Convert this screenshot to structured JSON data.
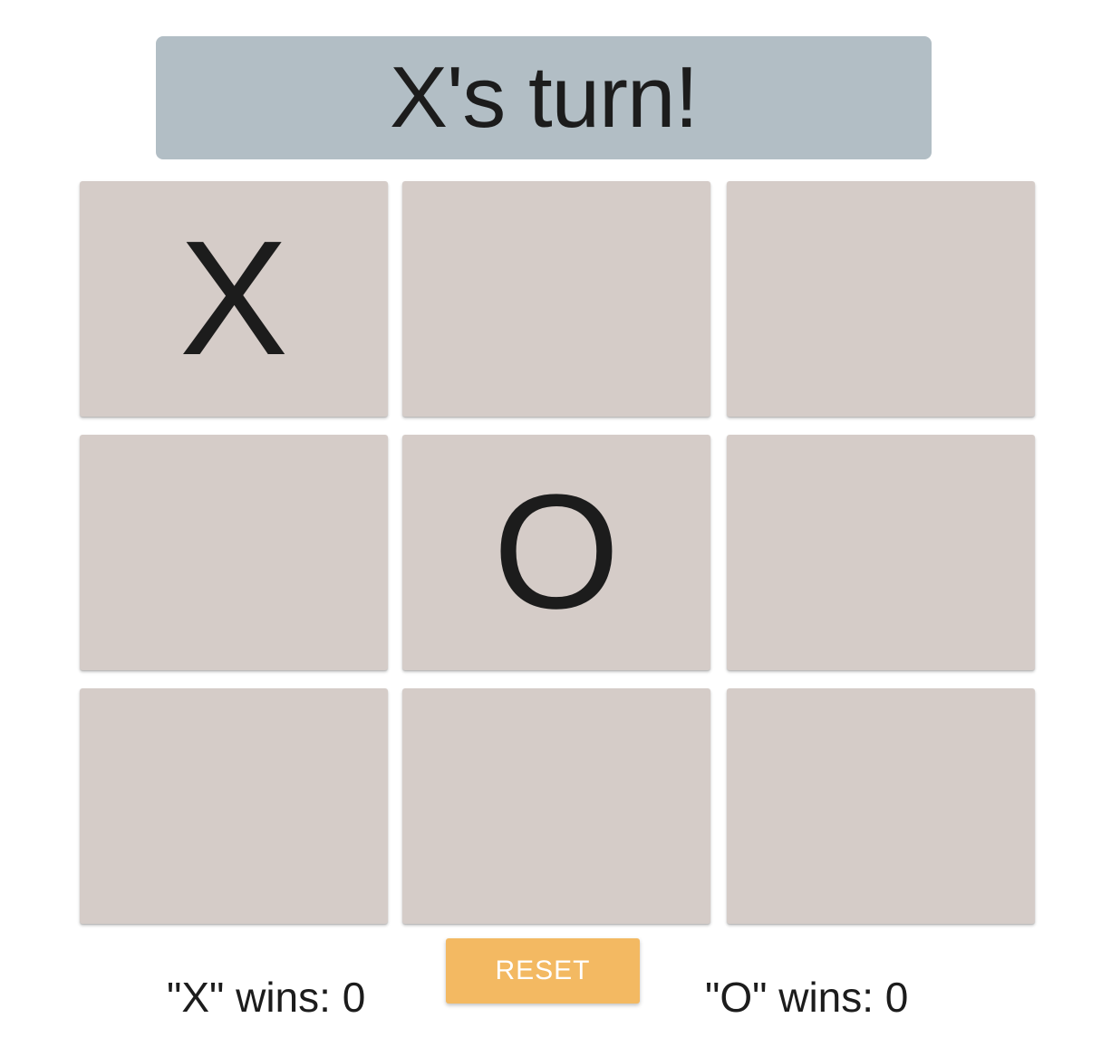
{
  "status": {
    "text": "X's turn!"
  },
  "board": {
    "cells": [
      "X",
      "",
      "",
      "",
      "O",
      "",
      "",
      "",
      ""
    ]
  },
  "scores": {
    "x_label": "\"X\" wins: 0",
    "o_label": "\"O\" wins: 0"
  },
  "controls": {
    "reset_label": "RESET"
  },
  "colors": {
    "banner": "#b2bec5",
    "cell": "#d5ccc8",
    "reset_button": "#f3b962",
    "text": "#1c1c1c"
  }
}
